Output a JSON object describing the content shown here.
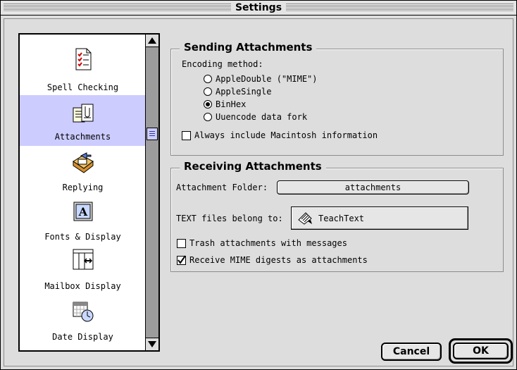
{
  "window": {
    "title": "Settings"
  },
  "sidebar": {
    "items": [
      {
        "label": "Spell Checking",
        "icon": "spell-checking-icon"
      },
      {
        "label": "Attachments",
        "icon": "attachments-icon",
        "selected": true
      },
      {
        "label": "Replying",
        "icon": "replying-icon"
      },
      {
        "label": "Fonts & Display",
        "icon": "fonts-display-icon"
      },
      {
        "label": "Mailbox Display",
        "icon": "mailbox-display-icon"
      },
      {
        "label": "Date Display",
        "icon": "date-display-icon"
      }
    ]
  },
  "sending": {
    "title": "Sending Attachments",
    "encoding_label": "Encoding method:",
    "options": [
      {
        "label": "AppleDouble (\"MIME\")",
        "checked": false
      },
      {
        "label": "AppleSingle",
        "checked": false
      },
      {
        "label": "BinHex",
        "checked": true
      },
      {
        "label": "Uuencode data fork",
        "checked": false
      }
    ],
    "always_include_label": "Always include Macintosh information",
    "always_include_checked": false
  },
  "receiving": {
    "title": "Receiving Attachments",
    "folder_label": "Attachment Folder:",
    "folder_value": "attachments",
    "text_files_label": "TEXT files belong to:",
    "text_files_app": "TeachText",
    "trash_label": "Trash attachments with messages",
    "trash_checked": false,
    "mime_digest_label": "Receive MIME digests as attachments",
    "mime_digest_checked": true
  },
  "buttons": {
    "cancel": "Cancel",
    "ok": "OK"
  },
  "colors": {
    "selection": "#ccccff",
    "window_bg": "#dddddd"
  }
}
